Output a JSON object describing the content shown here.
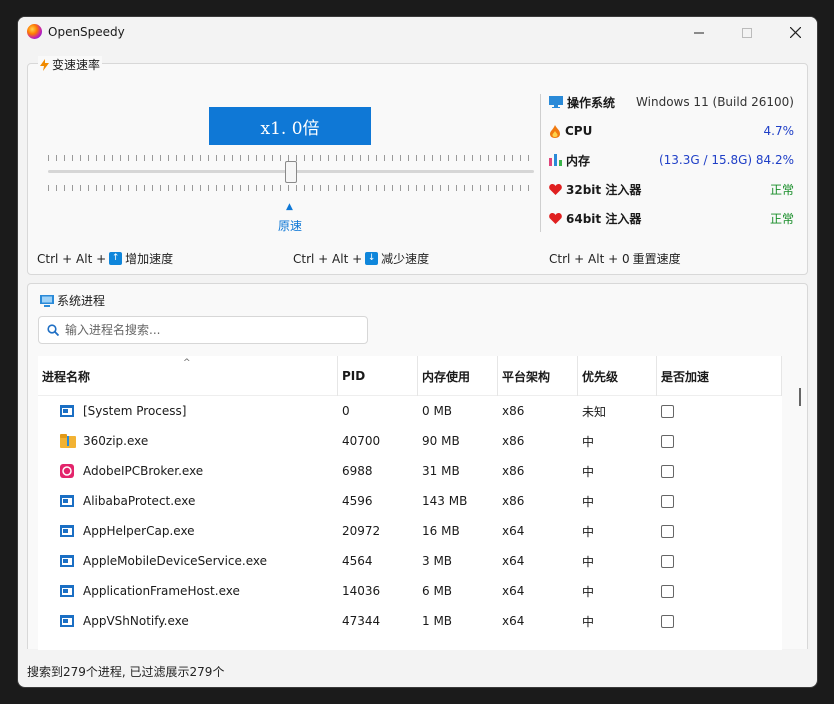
{
  "window": {
    "title": "OpenSpeedy"
  },
  "speed": {
    "group_title": "变速速率",
    "value_label": "x1. 0倍",
    "reset_label": "原速",
    "slider_value": 1.0,
    "hotkeys": [
      {
        "prefix": "Ctrl + Alt +",
        "key_icon": "arrow-up-icon",
        "action": "增加速度"
      },
      {
        "prefix": "Ctrl + Alt +",
        "key_icon": "arrow-down-icon",
        "action": "减少速度"
      },
      {
        "prefix": "Ctrl + Alt + 0",
        "key_icon": "",
        "action": "重置速度"
      }
    ]
  },
  "system": {
    "os_label": "操作系统",
    "os_value": "Windows 11 (Build 26100)",
    "cpu_label": "CPU",
    "cpu_value": "4.7%",
    "mem_label": "内存",
    "mem_value": "(13.3G / 15.8G) 84.2%",
    "inj32_label": "32bit 注入器",
    "inj32_value": "正常",
    "inj64_label": "64bit 注入器",
    "inj64_value": "正常"
  },
  "process": {
    "group_title": "系统进程",
    "search_placeholder": "输入进程名搜索...",
    "columns": [
      "进程名称",
      "PID",
      "内存使用",
      "平台架构",
      "优先级",
      "是否加速"
    ],
    "rows": [
      {
        "name": "[System Process]",
        "pid": "0",
        "mem": "0 MB",
        "arch": "x86",
        "prio": "未知",
        "icon": "window-icon"
      },
      {
        "name": "360zip.exe",
        "pid": "40700",
        "mem": "90 MB",
        "arch": "x86",
        "prio": "中",
        "icon": "zip-icon"
      },
      {
        "name": "AdobeIPCBroker.exe",
        "pid": "6988",
        "mem": "31 MB",
        "arch": "x86",
        "prio": "中",
        "icon": "adobe-icon"
      },
      {
        "name": "AlibabaProtect.exe",
        "pid": "4596",
        "mem": "143 MB",
        "arch": "x86",
        "prio": "中",
        "icon": "window-icon"
      },
      {
        "name": "AppHelperCap.exe",
        "pid": "20972",
        "mem": "16 MB",
        "arch": "x64",
        "prio": "中",
        "icon": "window-icon"
      },
      {
        "name": "AppleMobileDeviceService.exe",
        "pid": "4564",
        "mem": "3 MB",
        "arch": "x64",
        "prio": "中",
        "icon": "window-icon"
      },
      {
        "name": "ApplicationFrameHost.exe",
        "pid": "14036",
        "mem": "6 MB",
        "arch": "x64",
        "prio": "中",
        "icon": "window-icon"
      },
      {
        "name": "AppVShNotify.exe",
        "pid": "47344",
        "mem": "1 MB",
        "arch": "x64",
        "prio": "中",
        "icon": "window-icon"
      }
    ]
  },
  "status": {
    "text": "搜索到279个进程, 已过滤展示279个"
  },
  "colors": {
    "accent": "#0f78d6",
    "ok": "#178d28",
    "value_blue": "#1f3fc7"
  }
}
